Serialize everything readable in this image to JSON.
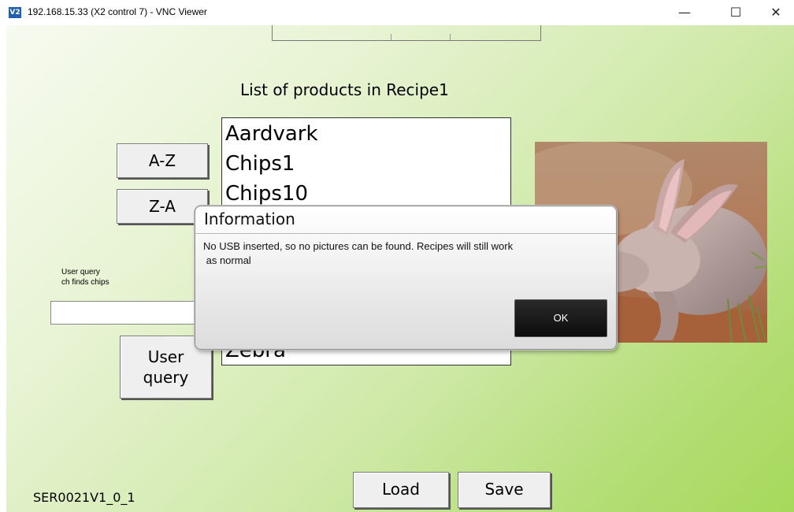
{
  "window": {
    "icon_text": "V2",
    "title": "192.168.15.33 (X2 control 7) - VNC Viewer",
    "minimize": "—",
    "maximize": "☐",
    "close": "✕"
  },
  "main": {
    "heading": "List of products in Recipe1",
    "sort_az_label": "A-Z",
    "sort_za_label": "Z-A",
    "user_query_hint_line1": "User query",
    "user_query_hint_line2": "ch finds chips",
    "user_query_input_value": "",
    "user_query_button_line1": "User",
    "user_query_button_line2": "query",
    "products": [
      "Aardvark",
      "Chips1",
      "Chips10",
      "Zebra"
    ],
    "image_subject": "aardvark-photo",
    "load_label": "Load",
    "save_label": "Save",
    "version": "SER0021V1_0_1"
  },
  "dialog": {
    "title": "Information",
    "message_line1": "No USB inserted, so no pictures can be found. Recipes will still work",
    "message_line2": " as normal",
    "ok_label": "OK"
  },
  "colors": {
    "background_light": "#f7fbf0",
    "background_green": "#a6d95b",
    "dialog_button": "#111111"
  }
}
